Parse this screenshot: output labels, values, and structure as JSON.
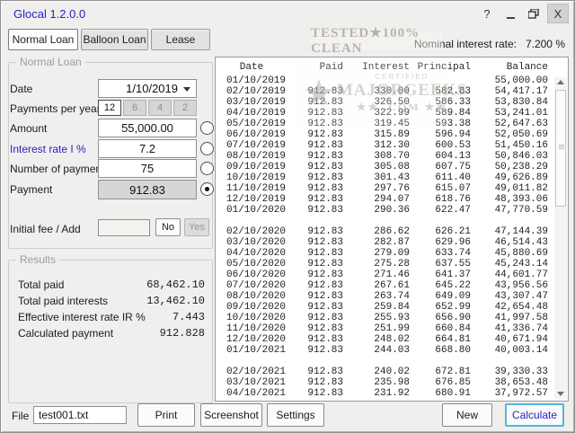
{
  "window": {
    "title": "Glocal 1.2.0.0",
    "controls": {
      "help": "?",
      "close": "X"
    }
  },
  "tabs": [
    {
      "label": "Normal Loan",
      "active": true
    },
    {
      "label": "Balloon Loan",
      "active": false
    },
    {
      "label": "Lease",
      "active": false
    }
  ],
  "nominal_rate": {
    "label": "Nominal interest rate:",
    "value": "7.200 %"
  },
  "form": {
    "group_title": "Normal Loan",
    "date": {
      "label": "Date",
      "value": "1/10/2019"
    },
    "payments_per_year": {
      "label": "Payments per year",
      "options": [
        "12",
        "6",
        "4",
        "2"
      ],
      "selected": "12"
    },
    "amount": {
      "label": "Amount",
      "value": "55,000.00"
    },
    "interest_rate": {
      "label": "Interest rate I %",
      "value": "7.2"
    },
    "number_of_payments": {
      "label": "Number of payments",
      "value": "75"
    },
    "payment": {
      "label": "Payment",
      "value": "912.83"
    },
    "initial_fee": {
      "label": "Initial fee / Add",
      "value": "",
      "no_label": "No",
      "yes_label": "Yes"
    },
    "selected_solve_for": "payment"
  },
  "results": {
    "group_title": "Results",
    "rows": [
      {
        "label": "Total paid",
        "value": "68,462.10"
      },
      {
        "label": "Total paid interests",
        "value": "13,462.10"
      },
      {
        "label": "Effective interest rate IR %",
        "value": "7.443"
      },
      {
        "label": "Calculated payment",
        "value": "912.828"
      }
    ]
  },
  "schedule": {
    "headers": [
      "Date",
      "Paid",
      "Interest",
      "Principal",
      "Balance"
    ],
    "rows": [
      [
        "01/10/2019",
        "",
        "",
        "",
        "55,000.00"
      ],
      [
        "02/10/2019",
        "912.83",
        "330.00",
        "582.83",
        "54,417.17"
      ],
      [
        "03/10/2019",
        "912.83",
        "326.50",
        "586.33",
        "53,830.84"
      ],
      [
        "04/10/2019",
        "912.83",
        "322.99",
        "589.84",
        "53,241.01"
      ],
      [
        "05/10/2019",
        "912.83",
        "319.45",
        "593.38",
        "52,647.63"
      ],
      [
        "06/10/2019",
        "912.83",
        "315.89",
        "596.94",
        "52,050.69"
      ],
      [
        "07/10/2019",
        "912.83",
        "312.30",
        "600.53",
        "51,450.16"
      ],
      [
        "08/10/2019",
        "912.83",
        "308.70",
        "604.13",
        "50,846.03"
      ],
      [
        "09/10/2019",
        "912.83",
        "305.08",
        "607.75",
        "50,238.29"
      ],
      [
        "10/10/2019",
        "912.83",
        "301.43",
        "611.40",
        "49,626.89"
      ],
      [
        "11/10/2019",
        "912.83",
        "297.76",
        "615.07",
        "49,011.82"
      ],
      [
        "12/10/2019",
        "912.83",
        "294.07",
        "618.76",
        "48,393.06"
      ],
      [
        "01/10/2020",
        "912.83",
        "290.36",
        "622.47",
        "47,770.59"
      ],
      [
        "",
        "",
        "",
        "",
        ""
      ],
      [
        "02/10/2020",
        "912.83",
        "286.62",
        "626.21",
        "47,144.39"
      ],
      [
        "03/10/2020",
        "912.83",
        "282.87",
        "629.96",
        "46,514.43"
      ],
      [
        "04/10/2020",
        "912.83",
        "279.09",
        "633.74",
        "45,880.69"
      ],
      [
        "05/10/2020",
        "912.83",
        "275.28",
        "637.55",
        "45,243.14"
      ],
      [
        "06/10/2020",
        "912.83",
        "271.46",
        "641.37",
        "44,601.77"
      ],
      [
        "07/10/2020",
        "912.83",
        "267.61",
        "645.22",
        "43,956.56"
      ],
      [
        "08/10/2020",
        "912.83",
        "263.74",
        "649.09",
        "43,307.47"
      ],
      [
        "09/10/2020",
        "912.83",
        "259.84",
        "652.99",
        "42,654.48"
      ],
      [
        "10/10/2020",
        "912.83",
        "255.93",
        "656.90",
        "41,997.58"
      ],
      [
        "11/10/2020",
        "912.83",
        "251.99",
        "660.84",
        "41,336.74"
      ],
      [
        "12/10/2020",
        "912.83",
        "248.02",
        "664.81",
        "40,671.94"
      ],
      [
        "01/10/2021",
        "912.83",
        "244.03",
        "668.80",
        "40,003.14"
      ],
      [
        "",
        "",
        "",
        "",
        ""
      ],
      [
        "02/10/2021",
        "912.83",
        "240.02",
        "672.81",
        "39,330.33"
      ],
      [
        "03/10/2021",
        "912.83",
        "235.98",
        "676.85",
        "38,653.48"
      ],
      [
        "04/10/2021",
        "912.83",
        "231.92",
        "680.91",
        "37,972.57"
      ]
    ]
  },
  "footer": {
    "file_label": "File",
    "file_value": "test001.txt",
    "left_buttons": [
      "Print",
      "Screenshot",
      "Settings"
    ],
    "right_buttons": [
      {
        "label": "New",
        "accent": false
      },
      {
        "label": "Calculate",
        "accent": true
      }
    ]
  },
  "watermark": {
    "badge": "TESTED★100% CLEAN",
    "certified": "CERTIFIED",
    "brand": "MAJORGEEKS",
    "dotcom": "★★ .COM ★★",
    "big_star": "★"
  },
  "colors": {
    "title_blue": "#2424c4",
    "label_blue": "#2424c4",
    "calculate_border": "#58b2dd",
    "payment_field_bg": "#d7d6d4",
    "window_bg": "#f0efed",
    "watermark_gray": "#b3afa7"
  }
}
